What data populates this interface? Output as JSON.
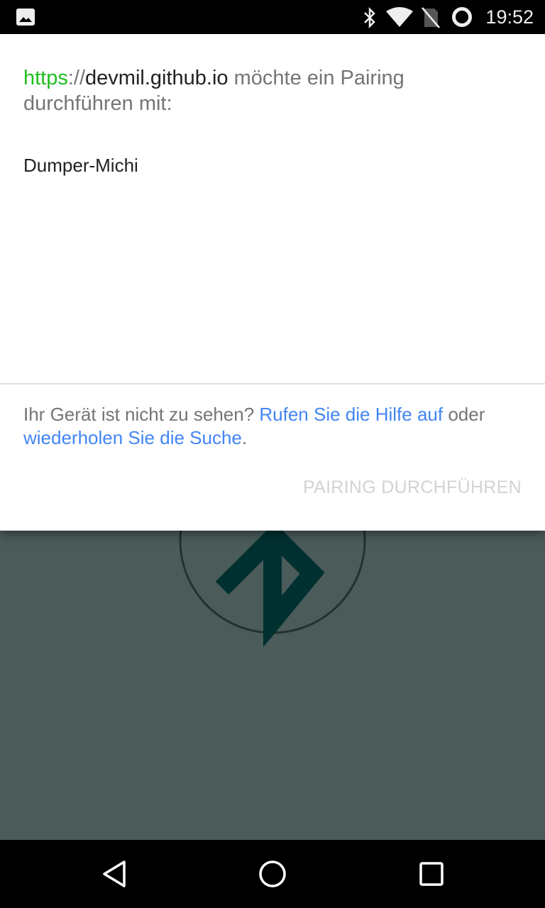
{
  "status_bar": {
    "time": "19:52",
    "icons": [
      "image-notification-icon",
      "bluetooth-icon",
      "wifi-icon",
      "no-sim-icon",
      "sync-progress-icon"
    ]
  },
  "dialog": {
    "origin_scheme": "https",
    "origin_sep": "://",
    "origin_host": "devmil.github.io",
    "title_rest": " möchte ein Pairing durchführen mit:",
    "devices": [
      {
        "name": "Dumper-Michi"
      }
    ],
    "help_prefix": "Ihr Gerät ist nicht zu sehen? ",
    "help_link": "Rufen Sie die Hilfe auf",
    "help_mid": " oder ",
    "retry_link": "wiederholen Sie die Suche",
    "help_suffix": ".",
    "pair_button": "PAIRING DURCHFÜHREN",
    "pair_button_enabled": false
  },
  "background": {
    "icon": "bluetooth-icon",
    "color": "#4a5b5a"
  },
  "nav_bar": {
    "icons": [
      "back-icon",
      "home-icon",
      "recents-icon"
    ]
  }
}
